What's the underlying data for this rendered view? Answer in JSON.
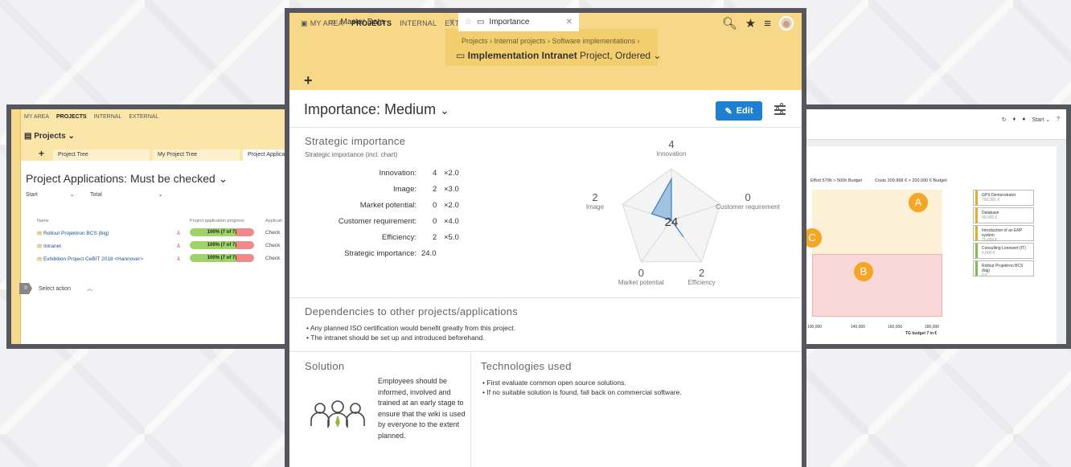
{
  "colors": {
    "header_yellow": "#f7d889",
    "accent_blue": "#1f7fd1",
    "radar_fill": "#5b9bd5"
  },
  "left_window": {
    "nav": [
      "MY AREA",
      "PROJECTS",
      "INTERNAL",
      "EXTERNAL"
    ],
    "projects_label": "Projects",
    "tabs": [
      "Project Tree",
      "My Project Tree",
      "Project Applica"
    ],
    "title": "Project Applications: Must be checked",
    "filters": [
      "Start",
      "Total"
    ],
    "columns": [
      "Name",
      "Project application progress",
      "Applicati"
    ],
    "rows": [
      {
        "name": "Rollout Projektron BCS (big)",
        "progress": "100% (7 of 7)",
        "status": "Check"
      },
      {
        "name": "Intranet",
        "progress": "100% (7 of 7)",
        "status": "Check"
      },
      {
        "name": "Exhibition Project CeBIT 2018 <Hannover>",
        "progress": "100% (7 of 7)",
        "status": "Check"
      }
    ],
    "select_count": "0",
    "select_action": "Select action"
  },
  "right_window": {
    "toolbar": "Start",
    "subtitle_effort": "Effort 579h > 500h Budget",
    "subtitle_costs": "Costs 209.968 € > 200.000 € Budget",
    "quadrants": [
      "A",
      "B",
      "C"
    ],
    "axis_ticks": [
      "100,000",
      "140,000",
      "160,000",
      "180,000"
    ],
    "axis_label": "TG budget 7 in €",
    "legend": [
      {
        "name": "GPS Demonstrator",
        "sub": "700,000 €",
        "color": "#f5a623"
      },
      {
        "name": "Database",
        "sub": "90,000 €",
        "color": "#f5a623"
      },
      {
        "name": "Introduction of an ERP system",
        "sub": "70,000 €",
        "color": "#f5a623"
      },
      {
        "name": "Consulting Lonowert (IT)",
        "sub": "6,000 €",
        "color": "#7bc043"
      },
      {
        "name": "Rollout Projektron BCS (big)",
        "sub": "0 €",
        "color": "#7bc043"
      }
    ]
  },
  "main": {
    "nav": [
      "MY AREA",
      "PROJECTS",
      "INTERNAL",
      "EXTERNAL"
    ],
    "breadcrumb": "Projects  ›  Internal projects  ›  Software implementations  ›",
    "project_title": "Implementation Intranet",
    "project_meta": "Project, Ordered",
    "tabs": [
      "Master Data",
      "Importance"
    ],
    "page_title": "Importance: Medium",
    "edit_label": "Edit",
    "strategic": {
      "heading": "Strategic importance",
      "subheading": "Strategic importance (incl. chart)",
      "criteria": [
        {
          "label": "Innovation:",
          "value": "4",
          "weight": "×2.0"
        },
        {
          "label": "Image:",
          "value": "2",
          "weight": "×3.0"
        },
        {
          "label": "Market potential:",
          "value": "0",
          "weight": "×2.0"
        },
        {
          "label": "Customer requirement:",
          "value": "0",
          "weight": "×4.0"
        },
        {
          "label": "Efficiency:",
          "value": "2",
          "weight": "×5.0"
        }
      ],
      "total_label": "Strategic importance:",
      "total_value": "24.0"
    },
    "radar": {
      "center_value": "24",
      "max": 5,
      "axes": [
        {
          "label": "Innovation",
          "value": 4
        },
        {
          "label": "Customer requirement",
          "value": 0
        },
        {
          "label": "Efficiency",
          "value": 2
        },
        {
          "label": "Market potential",
          "value": 0
        },
        {
          "label": "Image",
          "value": 2
        }
      ]
    },
    "dependencies": {
      "heading": "Dependencies to other projects/applications",
      "items": [
        "Any planned ISO certification would benefit greatly from this project.",
        "The intranet should be set up and introduced beforehand."
      ]
    },
    "solution": {
      "heading": "Solution",
      "text": "Employees should be informed, involved and trained at an early stage to ensure that the wiki is used by everyone to the extent planned."
    },
    "technologies": {
      "heading": "Technologies used",
      "items": [
        "First evaluate common open source solutions.",
        "If no suitable solution is found, fall back on commercial software."
      ]
    }
  }
}
